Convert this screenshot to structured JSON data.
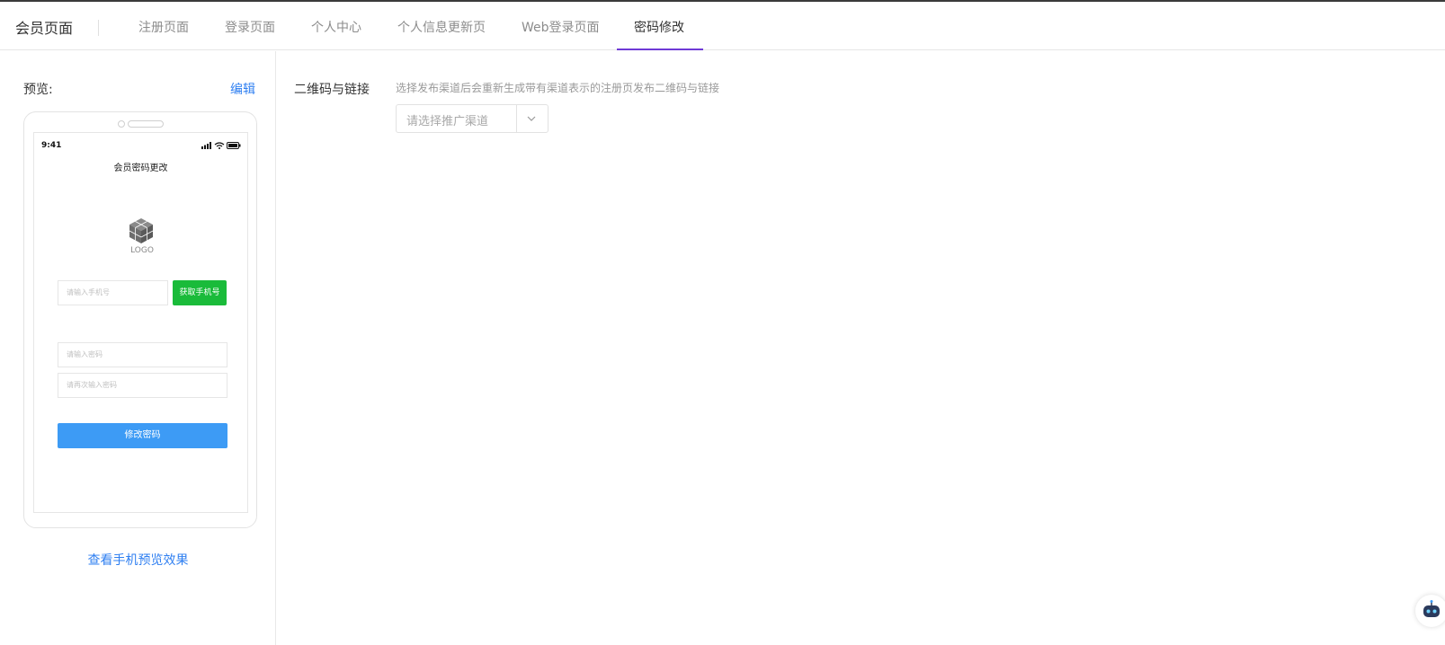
{
  "header": {
    "title": "会员页面",
    "tabs": [
      {
        "label": "注册页面",
        "active": false
      },
      {
        "label": "登录页面",
        "active": false
      },
      {
        "label": "个人中心",
        "active": false
      },
      {
        "label": "个人信息更新页",
        "active": false
      },
      {
        "label": "Web登录页面",
        "active": false
      },
      {
        "label": "密码修改",
        "active": true
      }
    ],
    "accent_color": "#6f3ad6"
  },
  "preview": {
    "label": "预览:",
    "edit_link": "编辑",
    "phone": {
      "status_time": "9:41",
      "page_title": "会员密码更改",
      "logo_text": "LOGO",
      "phone_placeholder": "请输入手机号",
      "get_phone_button": "获取手机号",
      "password_placeholder": "请输入密码",
      "confirm_password_placeholder": "请再次输入密码",
      "submit_button": "修改密码"
    },
    "view_link": "查看手机预览效果"
  },
  "qr_section": {
    "label": "二维码与链接",
    "description": "选择发布渠道后会重新生成带有渠道表示的注册页发布二维码与链接",
    "select_placeholder": "请选择推广渠道"
  },
  "colors": {
    "link": "#2f7ff1",
    "green_button": "#1abb3a",
    "blue_button": "#3d9bf5"
  }
}
